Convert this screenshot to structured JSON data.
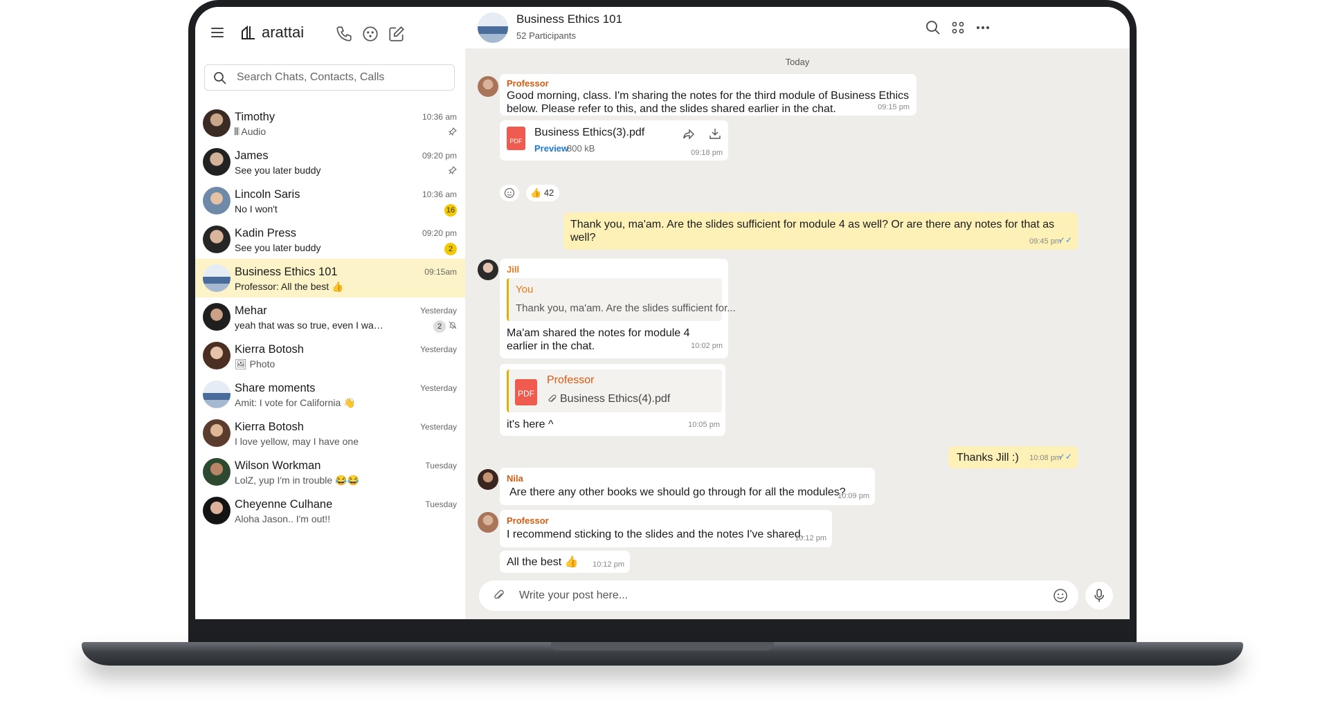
{
  "app": {
    "name": "arattai"
  },
  "search": {
    "placeholder": "Search Chats, Contacts, Calls"
  },
  "chats": [
    {
      "name": "Timothy",
      "message": "Audio",
      "time": "10:36 am",
      "pinned": true
    },
    {
      "name": "James",
      "message": "See you later buddy",
      "time": "09:20 pm",
      "pinned": true
    },
    {
      "name": "Lincoln Saris",
      "message": "No I won't",
      "time": "10:36 am",
      "badge": "16"
    },
    {
      "name": "Kadin Press",
      "message": "See you later buddy",
      "time": "09:20 pm",
      "badge": "2"
    },
    {
      "name": "Business Ethics 101",
      "message": "Professor: All the best 👍",
      "time": "09:15am",
      "selected": true
    },
    {
      "name": "Mehar",
      "message": "yeah that was so true, even I was plan...",
      "time": "Yesterday",
      "badge": "2",
      "muted": true
    },
    {
      "name": "Kierra Botosh",
      "message": "Photo",
      "time": "Yesterday"
    },
    {
      "name": "Share moments",
      "message": "Amit: I vote for California 👋",
      "time": "Yesterday"
    },
    {
      "name": "Kierra Botosh",
      "message": "I love yellow, may I have one",
      "time": "Yesterday"
    },
    {
      "name": "Wilson Workman",
      "message": "LolZ, yup I'm in trouble 😂😂",
      "time": "Tuesday"
    },
    {
      "name": "Cheyenne Culhane",
      "message": "Aloha Jason.. I'm out!!",
      "time": "Tuesday"
    }
  ],
  "conversation": {
    "title": "Business Ethics 101",
    "participants": "52 Participants",
    "day": "Today",
    "messages": {
      "m1": {
        "sender": "Professor",
        "text": "Good morning, class. I'm sharing the notes for the third module of Business Ethics below. Please refer to this, and the slides shared earlier in the chat.",
        "time": "09:15 pm"
      },
      "file1": {
        "name": "Business Ethics(3).pdf",
        "preview": "Preview",
        "size": "800 kB",
        "time": "09:18 pm",
        "type": "PDF"
      },
      "reaction": {
        "emoji": "👍",
        "count": "42"
      },
      "m2": {
        "text": "Thank you, ma'am. Are the slides sufficient for module 4 as well? Or are there any notes for that as well?",
        "time": "09:45 pm"
      },
      "m3": {
        "sender": "Jill",
        "quote_author": "You",
        "quote_text": "Thank you, ma'am. Are the slides sufficient for...",
        "text": "Ma'am shared the notes for module 4 earlier in the chat.",
        "time": "10:02 pm"
      },
      "m4": {
        "quote_author": "Professor",
        "quote_file": "Business Ethics(4).pdf",
        "text": "it's here ^",
        "time": "10:05 pm",
        "type": "PDF"
      },
      "m5": {
        "text": "Thanks Jill :)",
        "time": "10:08 pm"
      },
      "m6": {
        "sender": "Nila",
        "text": "Are there any other books we should go through for all the modules?",
        "time": "10:09 pm"
      },
      "m7": {
        "sender": "Professor",
        "text": "I recommend sticking to the slides and the notes I've shared.",
        "time": "10:12 pm"
      },
      "m8": {
        "text": "All the best 👍",
        "time": "10:12 pm"
      }
    }
  },
  "composer": {
    "placeholder": "Write your post here..."
  },
  "colors": {
    "accent": "#f4c800",
    "selected_bg": "#fdf3c8",
    "outgoing_bubble": "#fdf1b8",
    "sender_orange": "#d65a10",
    "link_blue": "#1b78d4",
    "chat_bg": "#eeedea"
  }
}
